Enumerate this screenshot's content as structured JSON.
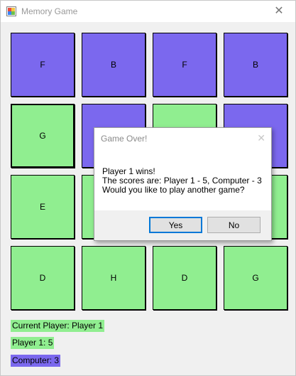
{
  "window": {
    "title": "Memory Game",
    "close_glyph": "✕"
  },
  "colors": {
    "hidden_card": "#7b68ee",
    "revealed_card": "#90ee90"
  },
  "cards": [
    [
      "F",
      "B",
      "F",
      "B"
    ],
    [
      "G",
      "",
      "",
      ""
    ],
    [
      "E",
      "",
      "",
      ""
    ],
    [
      "D",
      "H",
      "D",
      "G"
    ]
  ],
  "status": {
    "current_player": "Current Player: Player 1",
    "player1_score": "Player 1: 5",
    "computer_score": "Computer: 3"
  },
  "dialog": {
    "title": "Game Over!",
    "close_glyph": "✕",
    "line1": "Player 1 wins!",
    "line2": "The scores are: Player 1 - 5, Computer - 3",
    "line3": "Would you like to play another game?",
    "yes": "Yes",
    "no": "No"
  }
}
